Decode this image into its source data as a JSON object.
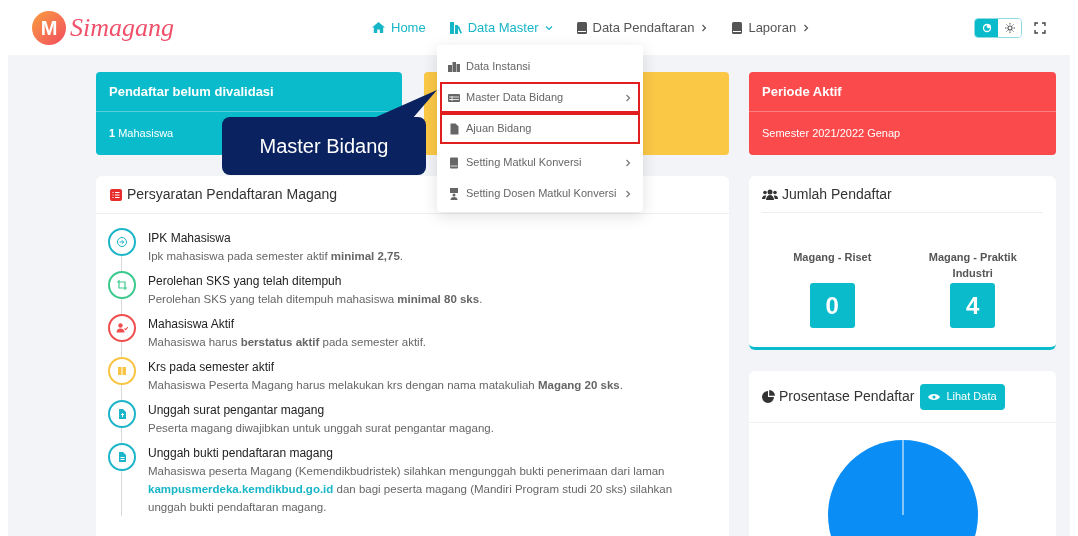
{
  "brand": {
    "logo_letter": "M",
    "name": "Simagang"
  },
  "nav": [
    {
      "label": "Home",
      "active": true
    },
    {
      "label": "Data Master",
      "active": true,
      "expanded": true
    },
    {
      "label": "Data Pendaftaran",
      "active": false,
      "expanded": false
    },
    {
      "label": "Laporan",
      "active": false,
      "expanded": false
    }
  ],
  "theme_toggle": {
    "dark_selected": true
  },
  "dropdown": [
    {
      "label": "Data Instansi",
      "submenu": false,
      "highlighted": false
    },
    {
      "label": "Master Data Bidang",
      "submenu": true,
      "highlighted": true
    },
    {
      "label": "Ajuan Bidang",
      "submenu": false,
      "highlighted": true
    },
    {
      "label": "Setting Matkul Konversi",
      "submenu": true,
      "highlighted": false
    },
    {
      "label": "Setting Dosen Matkul Konversi",
      "submenu": true,
      "highlighted": false
    }
  ],
  "callout": {
    "text": "Master Bidang"
  },
  "stat_cards": [
    {
      "title": "Pendaftar belum divalidasi",
      "value": "**1** Mahasiswa",
      "color": "#0abccb"
    },
    {
      "color": "#fbc846"
    }
  ],
  "requirements": {
    "title": "Persyaratan Pendaftaran Magang",
    "items": [
      {
        "title": "IPK Mahasiswa",
        "description": "Ipk mahasiswa pada semester aktif **minimal 2,75**.",
        "color": "#1cb5c9"
      },
      {
        "title": "Perolehan SKS yang telah ditempuh",
        "description": "Perolehan SKS yang telah ditempuh mahasiswa **minimal 80 sks**.",
        "color": "#3cc98d"
      },
      {
        "title": "Mahasiswa Aktif",
        "description": "Mahasiswa harus **berstatus aktif** pada semester aktif.",
        "color": "#f04e4e"
      },
      {
        "title": "Krs pada semester aktif",
        "description": "Mahasiswa Peserta Magang harus melakukan krs dengan nama matakuliah **Magang 20 sks**.",
        "color": "#f9c443"
      },
      {
        "title": "Unggah surat pengantar magang",
        "description": "Peserta magang diwajibkan untuk unggah surat pengantar magang.",
        "color": "#1cb5c9"
      },
      {
        "title": "Unggah bukti pendaftaran magang",
        "description": "Mahasiswa peserta Magang (Kemendikbudristek) silahkan mengunggah bukti penerimaan dari laman",
        "link": "kampusmerdeka.kemdikbud.go.id",
        "description_after": "dan bagi peserta magang (Mandiri Program studi 20 sks) silahkan unggah bukti pendaftaran magang.",
        "color": "#1cb5c9"
      }
    ]
  },
  "periode": {
    "title": "Periode Aktif",
    "value": "Semester 2021/2022 Genap"
  },
  "jumlah": {
    "title": "Jumlah Pendaftar",
    "groups": [
      {
        "label": "Magang - Riset",
        "count": "0"
      },
      {
        "label": "Magang - Praktik Industri",
        "count": "4"
      }
    ]
  },
  "prosentase": {
    "title": "Prosentase Pendaftar",
    "button": "Lihat Data"
  }
}
